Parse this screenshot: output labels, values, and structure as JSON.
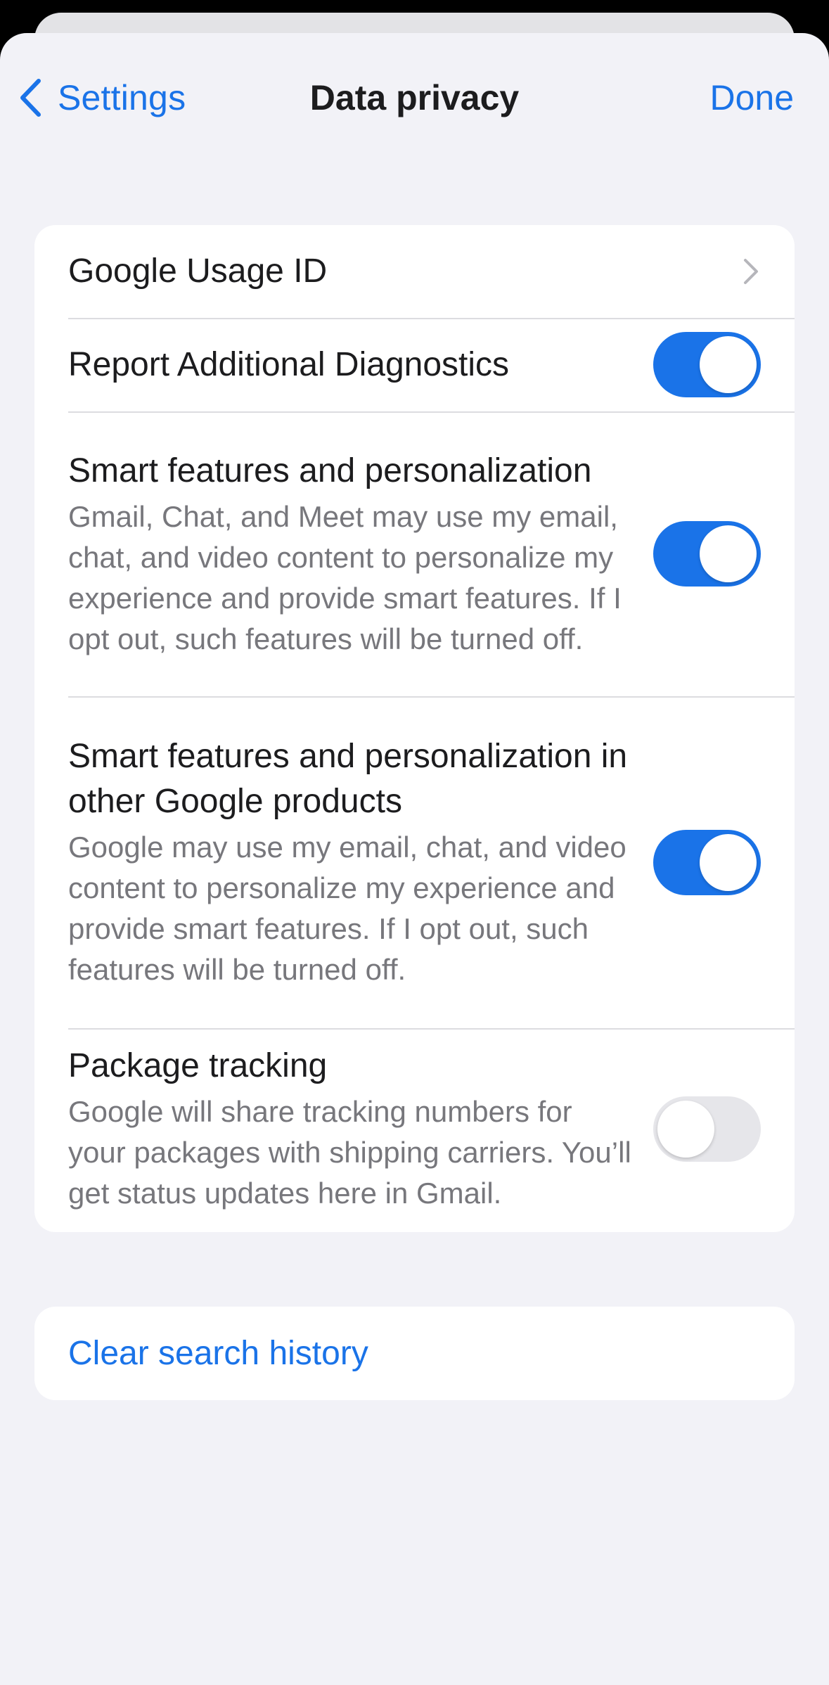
{
  "nav": {
    "back_label": "Settings",
    "title": "Data privacy",
    "done_label": "Done"
  },
  "settings": {
    "usage_id": {
      "title": "Google Usage ID"
    },
    "diagnostics": {
      "title": "Report Additional Diagnostics",
      "enabled": true
    },
    "smart_features": {
      "title": "Smart features and personalization",
      "description": "Gmail, Chat, and Meet may use my email, chat, and video content to personalize my experience and provide smart features. If I opt out, such features will be turned off.",
      "enabled": true
    },
    "smart_other": {
      "title": "Smart features and personalization in other Google products",
      "description": "Google may use my email, chat, and video content to personalize my experience and provide smart features. If I opt out, such features will be turned off.",
      "enabled": true
    },
    "package_tracking": {
      "title": "Package tracking",
      "description": "Google will share tracking numbers for your packages with shipping carriers. You’ll get status updates here in Gmail.",
      "enabled": false
    }
  },
  "actions": {
    "clear_history_label": "Clear search history"
  },
  "colors": {
    "accent": "#1a73e8",
    "background": "#f2f2f7",
    "card": "#ffffff",
    "toggle_off": "#e6e6ea",
    "secondary_text": "#77777c"
  },
  "icons": {
    "back": "chevron-left-icon",
    "disclosure": "chevron-right-icon"
  }
}
